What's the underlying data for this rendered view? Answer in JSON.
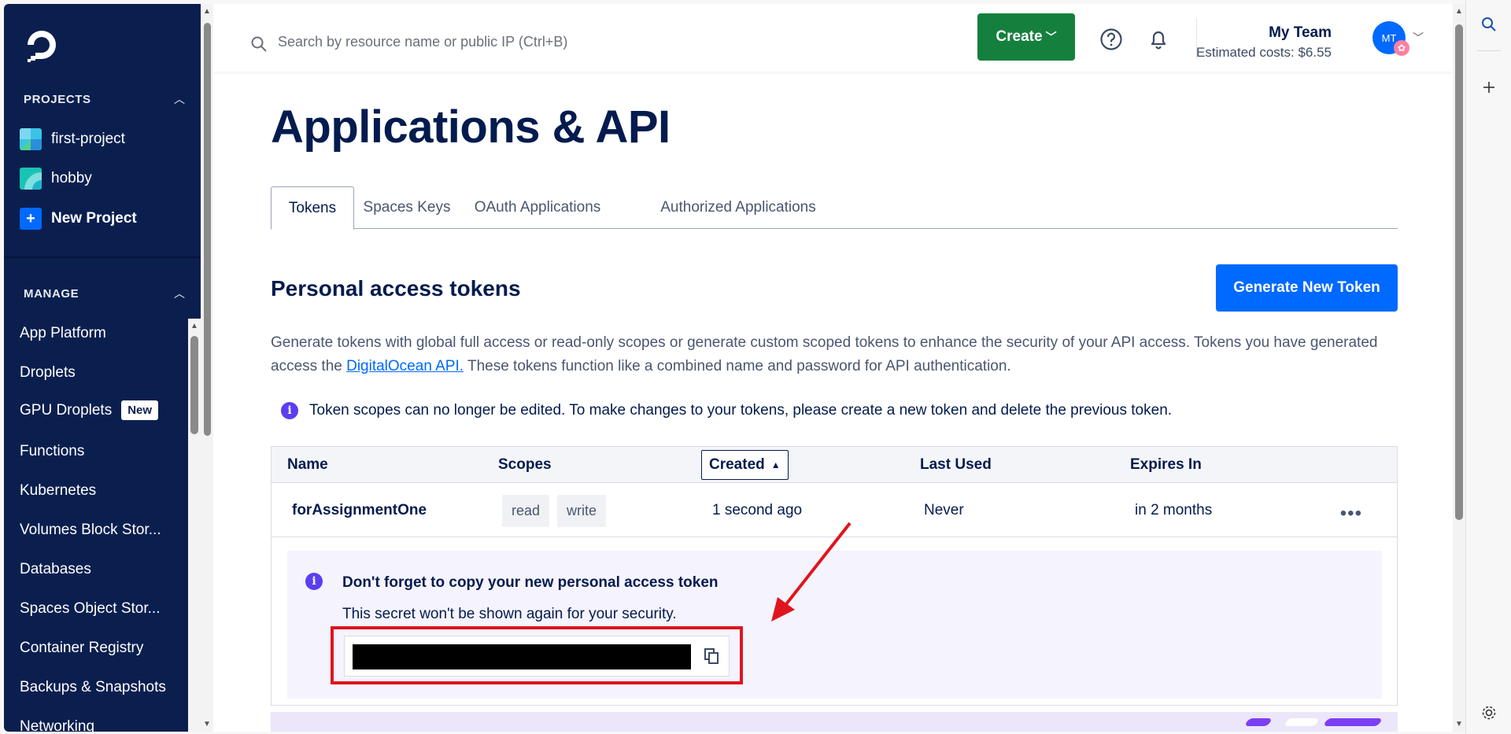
{
  "sidebar": {
    "projects_header": "PROJECTS",
    "projects": [
      {
        "label": "first-project"
      },
      {
        "label": "hobby"
      }
    ],
    "new_project_label": "New Project",
    "manage_header": "MANAGE",
    "manage_items": [
      {
        "label": "App Platform"
      },
      {
        "label": "Droplets"
      },
      {
        "label": "GPU Droplets",
        "badge": "New"
      },
      {
        "label": "Functions"
      },
      {
        "label": "Kubernetes"
      },
      {
        "label": "Volumes Block Stor..."
      },
      {
        "label": "Databases"
      },
      {
        "label": "Spaces Object Stor..."
      },
      {
        "label": "Container Registry"
      },
      {
        "label": "Backups & Snapshots"
      },
      {
        "label": "Networking"
      }
    ]
  },
  "topbar": {
    "search_placeholder": "Search by resource name or public IP (Ctrl+B)",
    "create_label": "Create",
    "team_name": "My Team",
    "estimated_costs": "Estimated costs: $6.55",
    "avatar_initials": "MT"
  },
  "page": {
    "title": "Applications & API",
    "tabs": [
      {
        "label": "Tokens",
        "active": true
      },
      {
        "label": "Spaces Keys"
      },
      {
        "label": "OAuth Applications"
      },
      {
        "label": "Authorized Applications"
      }
    ],
    "section_title": "Personal access tokens",
    "generate_button": "Generate New Token",
    "description_part1": "Generate tokens with global full access or read-only scopes or generate custom scoped tokens to enhance the security of your API access. Tokens you have generated access the ",
    "description_link": "DigitalOcean API.",
    "description_part2": " These tokens function like a combined name and password for API authentication.",
    "info_text": "Token scopes can no longer be edited. To make changes to your tokens, please create a new token and delete the previous token."
  },
  "table": {
    "columns": [
      "Name",
      "Scopes",
      "Created",
      "Last Used",
      "Expires In"
    ],
    "sorted_column": "Created",
    "rows": [
      {
        "name": "forAssignmentOne",
        "scopes": [
          "read",
          "write"
        ],
        "created": "1 second ago",
        "last_used": "Never",
        "expires_in": "in 2 months"
      }
    ]
  },
  "notice": {
    "title": "Don't forget to copy your new personal access token",
    "subtitle": "This secret won't be shown again for your security."
  },
  "colors": {
    "sidebar_bg": "#0b1f4f",
    "primary_blue": "#0069ff",
    "create_green": "#15803d",
    "info_purple": "#5a3ff1",
    "annotation_red": "#e0141e"
  }
}
